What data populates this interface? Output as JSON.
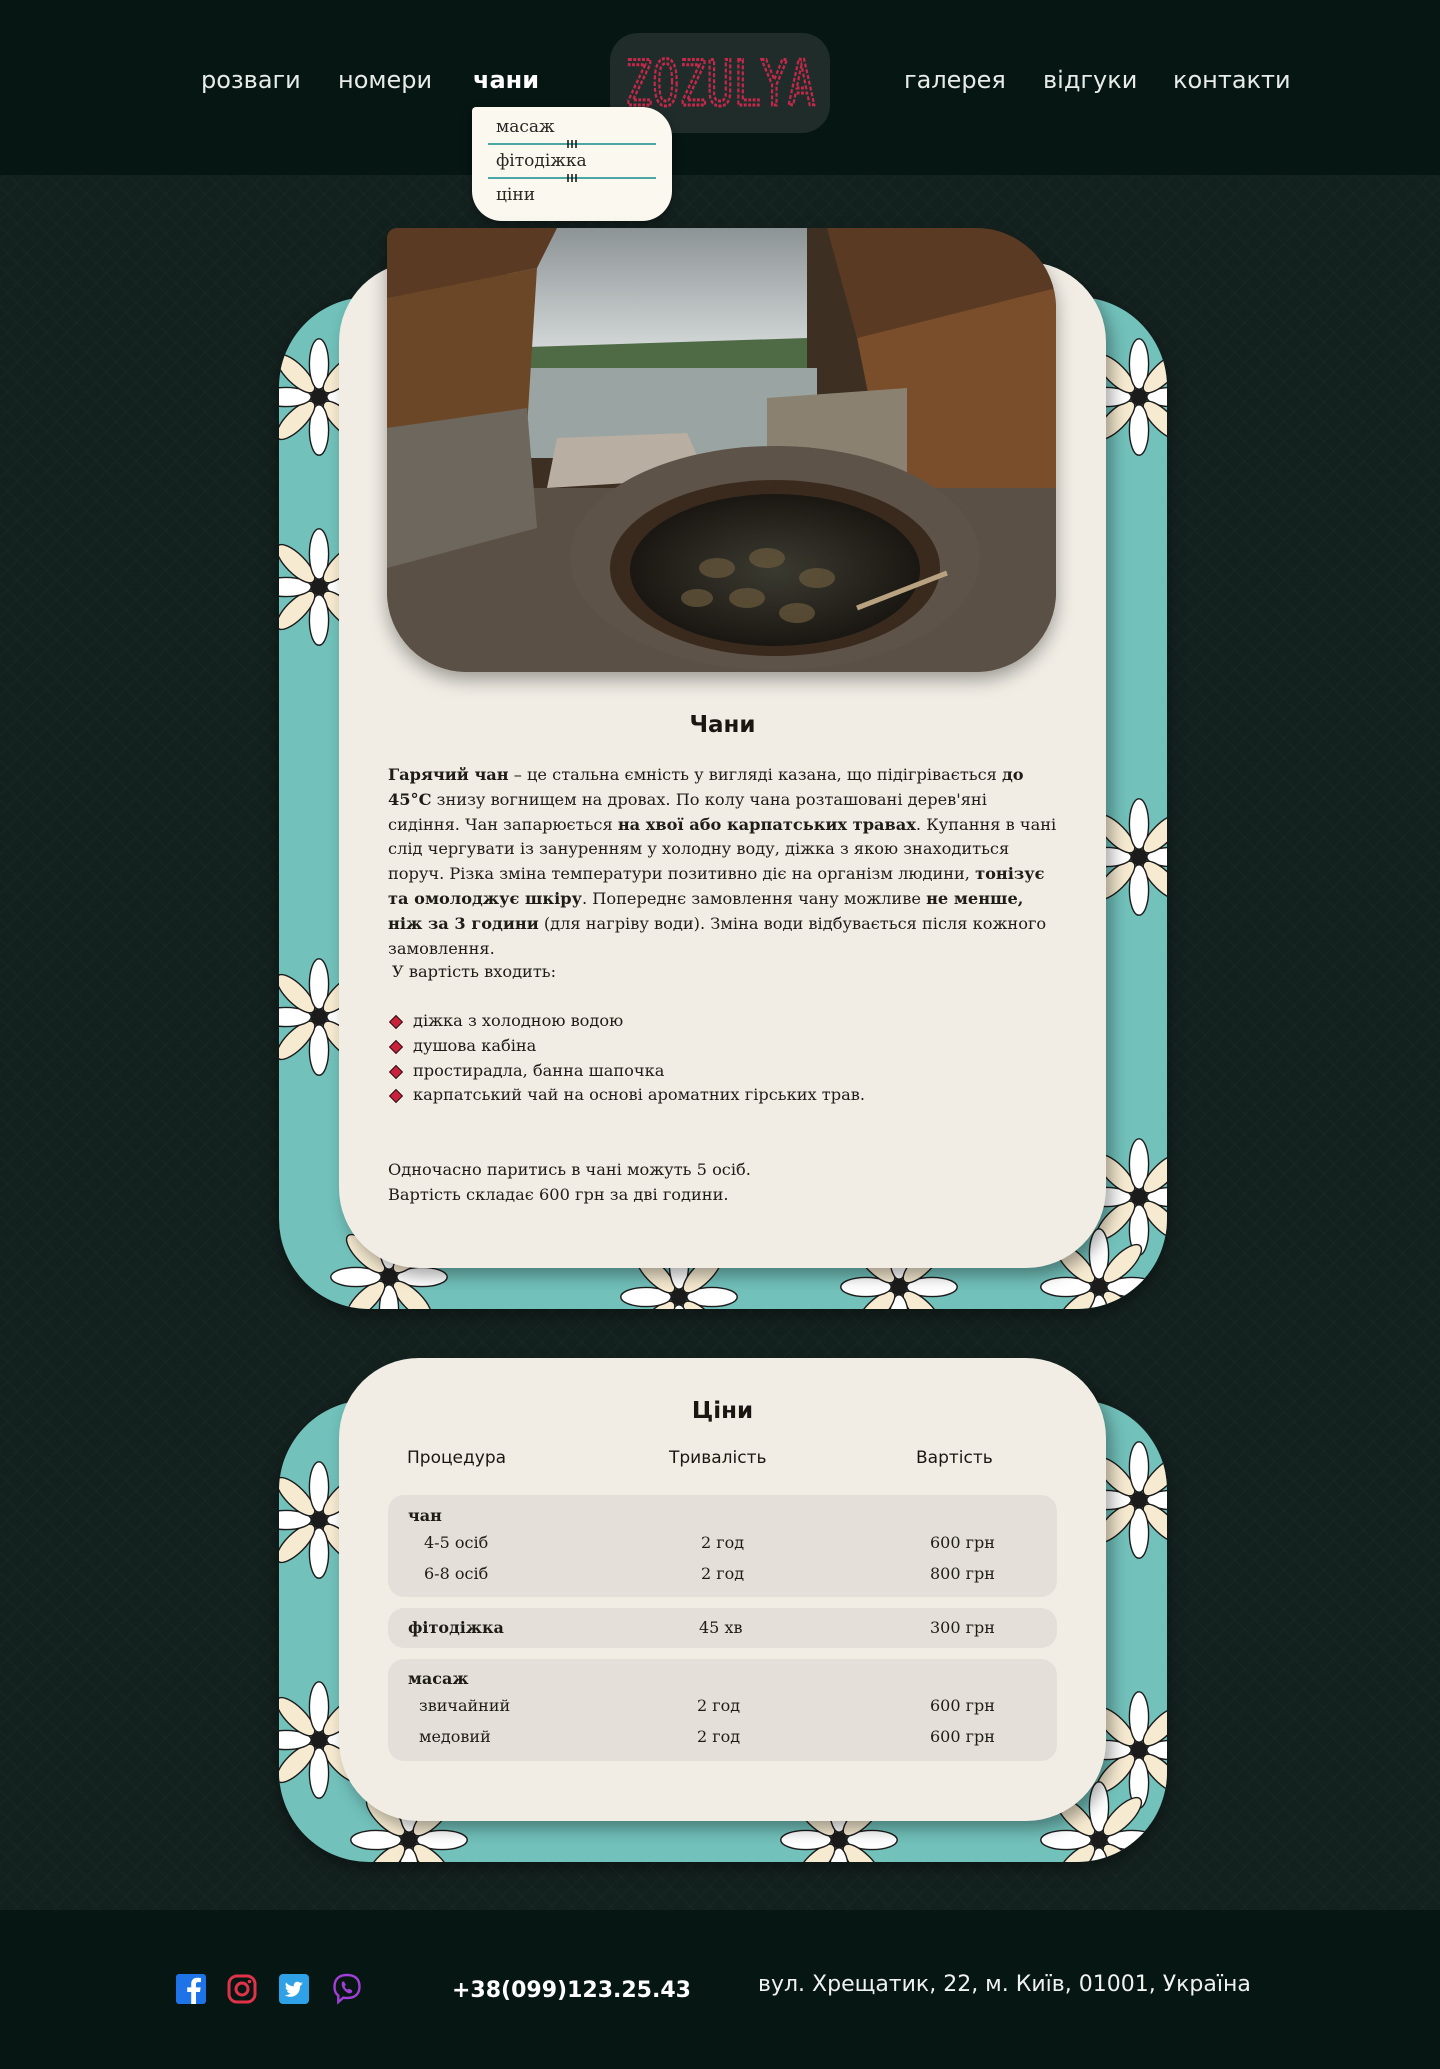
{
  "nav": {
    "left": [
      "розваги",
      "номери",
      "чани"
    ],
    "right": [
      "галерея",
      "відгуки",
      "контакти"
    ],
    "active": "чани"
  },
  "logo": {
    "text": "ZOZULYA"
  },
  "dropdown": {
    "items": [
      "масаж",
      "фітодіжка",
      "ціни"
    ]
  },
  "chany": {
    "title": "Чани",
    "photo_alt": "Гарячий чан біля озера",
    "paragraph": [
      {
        "t": "Гарячий чан",
        "b": true
      },
      {
        "t": " – це стальна ємність у вигляді  казана, що підігрівається ",
        "b": false
      },
      {
        "t": "до 45°С",
        "b": true
      },
      {
        "t": " знизу вогнищем на дровах. По колу чана розташовані дерев'яні сидіння. Чан запарюється ",
        "b": false
      },
      {
        "t": "на хвої або карпатських травах",
        "b": true
      },
      {
        "t": ". Купання в чані слід чергувати із зануренням у холодну воду, діжка з якою знаходиться поруч. Різка зміна температури позитивно діє на організм людини, ",
        "b": false
      },
      {
        "t": "тонізує та омолоджує шкіру",
        "b": true
      },
      {
        "t": ". Попереднє замовлення чану можливе ",
        "b": false
      },
      {
        "t": "не менше, ніж за 3 години",
        "b": true
      },
      {
        "t": " (для нагріву води). Зміна води відбувається після кожного замовлення.",
        "b": false
      }
    ],
    "includes_title": "У вартість входить:",
    "includes": [
      "діжка з холодною водою",
      "душова кабіна",
      "простирадла, банна шапочка",
      "карпатський чай на основі ароматних гірських трав."
    ],
    "note1": "Одночасно паритись в чані можуть 5 осіб.",
    "note2": "Вартість складає 600 грн за дві години."
  },
  "prices": {
    "title": "Ціни",
    "headers": [
      "Процедура",
      "Тривалість",
      "Вартість"
    ],
    "chan": {
      "name": "чан",
      "rows": [
        [
          "4-5 осіб",
          "2 год",
          "600 грн"
        ],
        [
          "6-8 осіб",
          "2 год",
          "800 грн"
        ]
      ]
    },
    "fito": {
      "name": "фітодіжка",
      "duration": "45 хв",
      "price": "300 грн"
    },
    "masazh": {
      "name": "масаж",
      "rows": [
        [
          "звичайний",
          "2 год",
          "600 грн"
        ],
        [
          "медовий",
          "2 год",
          "600 грн"
        ]
      ]
    }
  },
  "footer": {
    "social": [
      "facebook-icon",
      "instagram-icon",
      "twitter-icon",
      "viber-icon"
    ],
    "phone": "+38(099)123.25.43",
    "address": "вул. Хрещатик, 22, м. Київ, 01001, Україна"
  },
  "colors": {
    "accent": "#72c1bb",
    "logo": "#c4284a",
    "card": "#f1ede5",
    "header": "#061612",
    "bullet": "#c9233b"
  }
}
